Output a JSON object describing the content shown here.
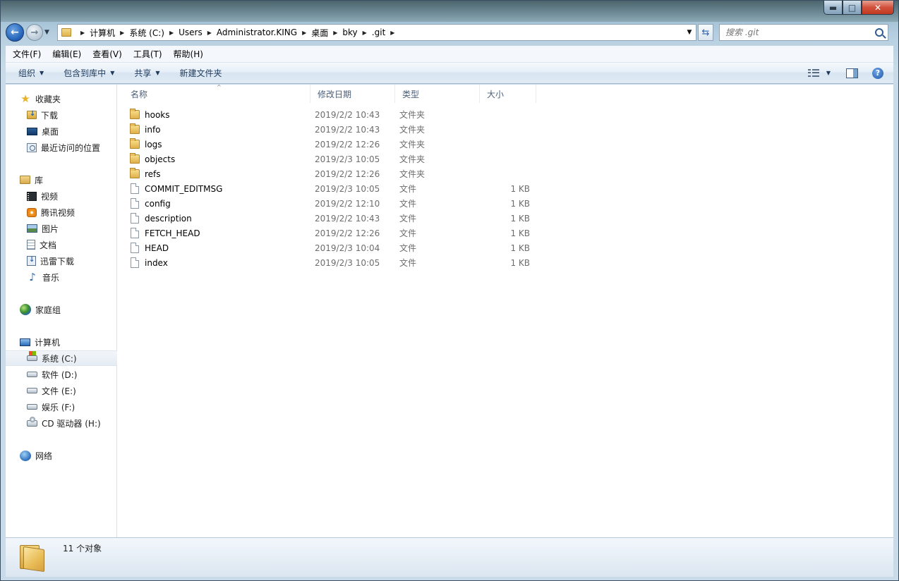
{
  "window": {
    "controls": {
      "minimize": "▬",
      "maximize": "□",
      "close": "✕"
    }
  },
  "nav": {
    "breadcrumbs": [
      "计算机",
      "系统 (C:)",
      "Users",
      "Administrator.KING",
      "桌面",
      "bky",
      ".git"
    ],
    "search_placeholder": "搜索 .git"
  },
  "menu": [
    "文件(F)",
    "编辑(E)",
    "查看(V)",
    "工具(T)",
    "帮助(H)"
  ],
  "toolbar": {
    "organize": "组织",
    "include_library": "包含到库中",
    "share": "共享",
    "new_folder": "新建文件夹"
  },
  "sidebar": {
    "favorites": {
      "label": "收藏夹",
      "items": [
        "下载",
        "桌面",
        "最近访问的位置"
      ]
    },
    "libraries": {
      "label": "库",
      "items": [
        "视频",
        "腾讯视频",
        "图片",
        "文档",
        "迅雷下载",
        "音乐"
      ]
    },
    "homegroup": {
      "label": "家庭组"
    },
    "computer": {
      "label": "计算机",
      "items": [
        "系统 (C:)",
        "软件 (D:)",
        "文件 (E:)",
        "娱乐 (F:)",
        "CD 驱动器 (H:)"
      ],
      "selected": "系统 (C:)"
    },
    "network": {
      "label": "网络"
    }
  },
  "columns": {
    "name": "名称",
    "modified": "修改日期",
    "type": "类型",
    "size": "大小"
  },
  "files": [
    {
      "name": "hooks",
      "modified": "2019/2/2 10:43",
      "type": "文件夹",
      "size": "",
      "kind": "folder"
    },
    {
      "name": "info",
      "modified": "2019/2/2 10:43",
      "type": "文件夹",
      "size": "",
      "kind": "folder"
    },
    {
      "name": "logs",
      "modified": "2019/2/2 12:26",
      "type": "文件夹",
      "size": "",
      "kind": "folder"
    },
    {
      "name": "objects",
      "modified": "2019/2/3 10:05",
      "type": "文件夹",
      "size": "",
      "kind": "folder"
    },
    {
      "name": "refs",
      "modified": "2019/2/2 12:26",
      "type": "文件夹",
      "size": "",
      "kind": "folder"
    },
    {
      "name": "COMMIT_EDITMSG",
      "modified": "2019/2/3 10:05",
      "type": "文件",
      "size": "1 KB",
      "kind": "file"
    },
    {
      "name": "config",
      "modified": "2019/2/2 12:10",
      "type": "文件",
      "size": "1 KB",
      "kind": "file"
    },
    {
      "name": "description",
      "modified": "2019/2/2 10:43",
      "type": "文件",
      "size": "1 KB",
      "kind": "file"
    },
    {
      "name": "FETCH_HEAD",
      "modified": "2019/2/2 12:26",
      "type": "文件",
      "size": "1 KB",
      "kind": "file"
    },
    {
      "name": "HEAD",
      "modified": "2019/2/3 10:04",
      "type": "文件",
      "size": "1 KB",
      "kind": "file"
    },
    {
      "name": "index",
      "modified": "2019/2/3 10:05",
      "type": "文件",
      "size": "1 KB",
      "kind": "file"
    }
  ],
  "status": {
    "count_text": "11 个对象"
  }
}
